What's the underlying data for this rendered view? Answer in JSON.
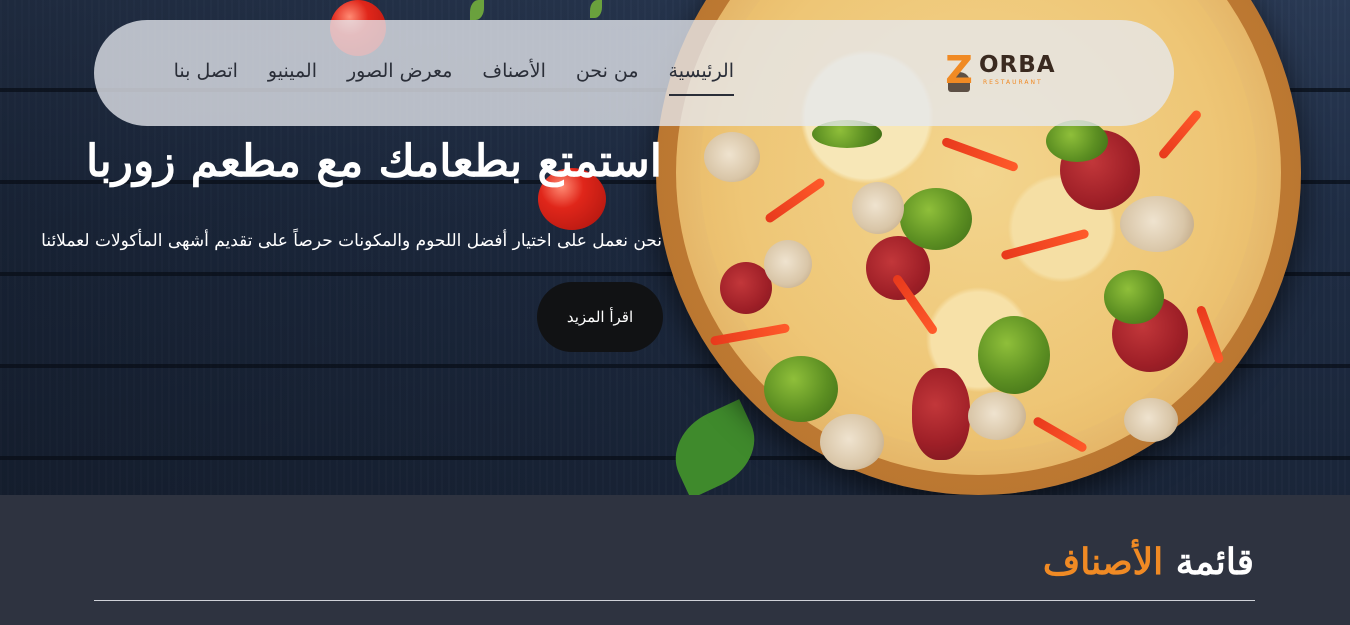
{
  "brand": {
    "name": "ORBA",
    "initial": "Z",
    "tagline": "RESTAURANT"
  },
  "nav": {
    "items": [
      {
        "label": "الرئيسية",
        "active": true
      },
      {
        "label": "من نحن",
        "active": false
      },
      {
        "label": "الأصناف",
        "active": false
      },
      {
        "label": "معرض الصور",
        "active": false
      },
      {
        "label": "المينيو",
        "active": false
      },
      {
        "label": "اتصل بنا",
        "active": false
      }
    ]
  },
  "hero": {
    "title": "استمتع بطعامك مع مطعم زوربا",
    "subtitle": "نحن نعمل على اختيار أفضل اللحوم والمكونات حرصاً على تقديم أشهى المأكولات لعملائنا",
    "button_label": "اقرأ المزيد"
  },
  "categories": {
    "title_main": "قائمة",
    "title_accent": "الأصناف"
  },
  "colors": {
    "accent": "#f08a24",
    "section_bg": "#2e3340",
    "button_bg": "#111214"
  }
}
